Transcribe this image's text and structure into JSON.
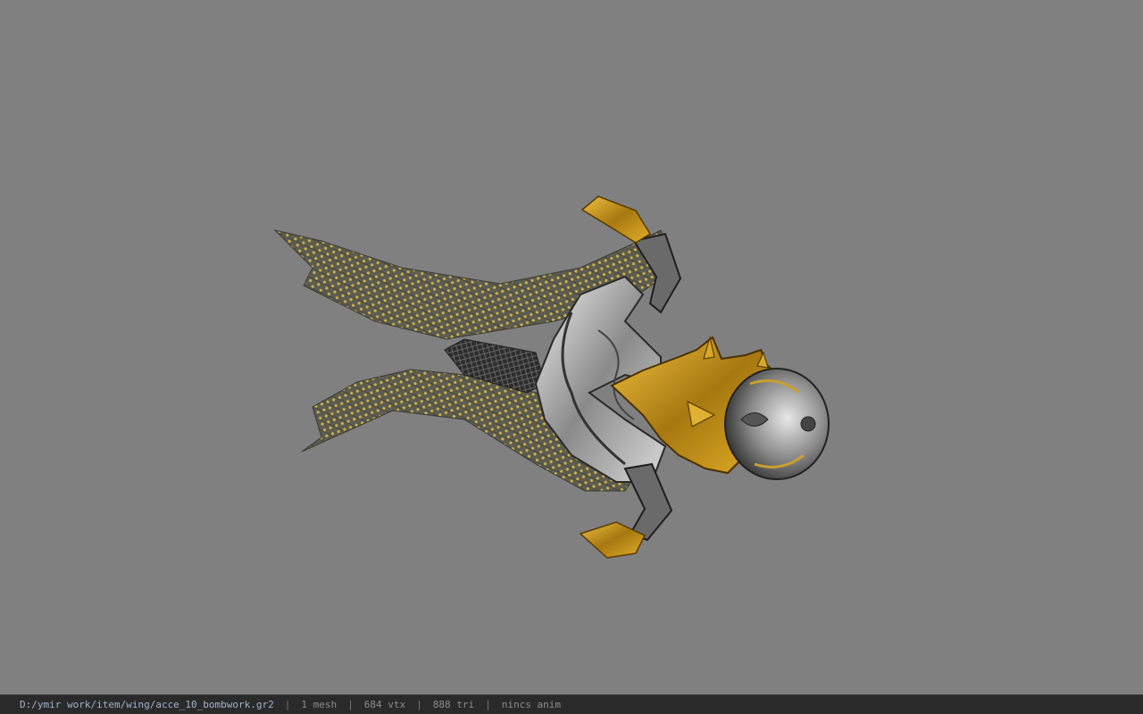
{
  "viewer": {
    "background_color": "#808080",
    "model_icon": "wing-accessory-model"
  },
  "status_bar": {
    "file_path": "D:/ymir work/item/wing/acce_10_bombwork.gr2",
    "separator": "|",
    "mesh_count": "1 mesh",
    "vertex_count": "684 vtx",
    "triangle_count": "888 tri",
    "anim_label": "nincs anim"
  }
}
